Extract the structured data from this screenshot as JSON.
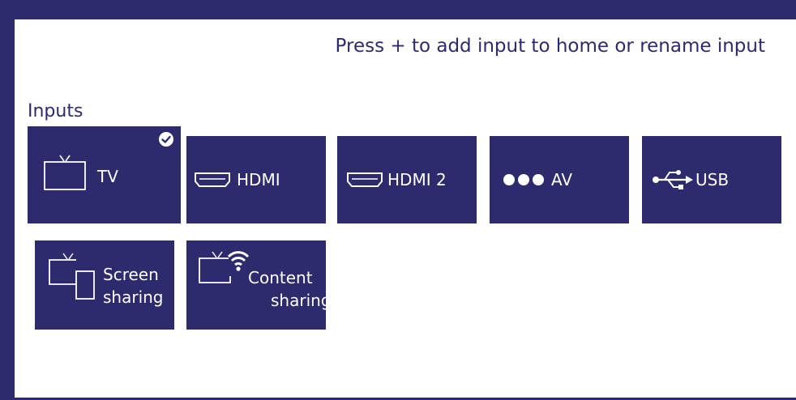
{
  "header": {
    "hint": "Press + to add input to home or rename input"
  },
  "inputs": {
    "title": "Inputs",
    "tiles": [
      {
        "label": "TV",
        "icon": "tv-icon",
        "selected": true
      },
      {
        "label": "HDMI",
        "icon": "hdmi-port-icon"
      },
      {
        "label": "HDMI 2",
        "icon": "hdmi-port-icon"
      },
      {
        "label": "AV",
        "icon": "av-dots-icon"
      },
      {
        "label": "USB",
        "icon": "usb-icon"
      },
      {
        "label_line1": "Screen",
        "label_line2": "sharing",
        "icon": "screen-sharing-icon"
      },
      {
        "label_line1": "Content",
        "label_line2": "sharing",
        "icon": "content-sharing-icon"
      }
    ]
  },
  "colors": {
    "accent": "#2d2b6e",
    "background": "#ffffff"
  }
}
